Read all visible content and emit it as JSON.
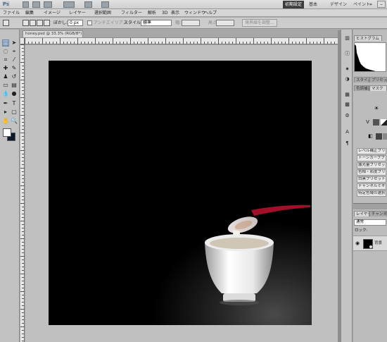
{
  "app": {
    "logo_text": "Ps",
    "workspaces": [
      "初期設定",
      "基本",
      "デザイン",
      "ペイント"
    ],
    "overflow_label": "»"
  },
  "menu": [
    "ファイル",
    "編集",
    "イメージ",
    "レイヤー",
    "選択範囲",
    "フィルター",
    "解析",
    "3D",
    "表示",
    "ウィンドウ",
    "ヘルプ"
  ],
  "options": {
    "feather_label": "ぼかし:",
    "feather_value": "0 px",
    "antialias_label": "アンチエイリアス",
    "style_label": "スタイル:",
    "style_value": "標準",
    "width_label": "幅:",
    "height_label": "高さ:",
    "refine_button": "境界線を調整..."
  },
  "document": {
    "tab_title": "honey.psd @ 33.3% (RGB/8*)"
  },
  "panels": {
    "tab_histogram": "ヒストグラム",
    "tab_info": "情報",
    "tab_adjustments": "色調補正",
    "tab_masks": "マスク",
    "tab_styles": "スタイル",
    "tab_presets": "プリセット",
    "adjust_presets": [
      "レベル補正プリセット",
      "トーンカーブプリセット",
      "露光量プリセット",
      "色相・彩度プリセット",
      "白黒プリセット",
      "チャンネルミキサー",
      "特定色域の選択"
    ],
    "tab_layers": "レイヤー",
    "tab_channels": "チャンネル",
    "blend_mode": "通常",
    "lock_label": "ロック:",
    "layer_name": "背景"
  },
  "colors": {
    "foreground": "#ffffff",
    "background": "#0b1a2a",
    "accent": "#9fb8d4",
    "canvas_bg": "#000000"
  }
}
